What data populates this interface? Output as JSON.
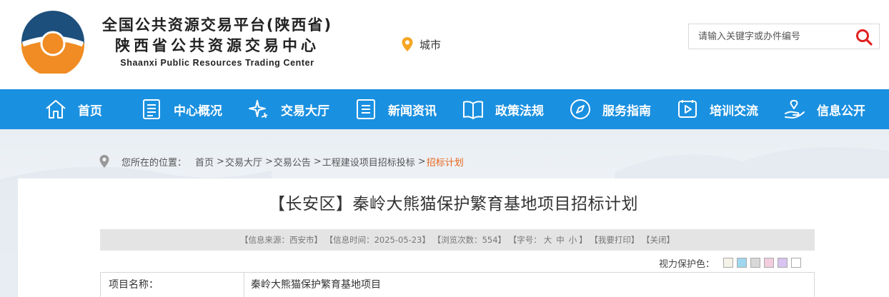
{
  "header": {
    "title_cn_line1": "全国公共资源交易平台(陕西省)",
    "title_cn_line2": "陕西省公共资源交易中心",
    "title_en": "Shaanxi Public Resources Trading Center",
    "city_label": "城市",
    "search_placeholder": "请输入关键字或办件编号"
  },
  "nav": {
    "items": [
      {
        "label": "首页",
        "icon": "home-icon"
      },
      {
        "label": "中心概况",
        "icon": "document-icon"
      },
      {
        "label": "交易大厅",
        "icon": "sparkle-icon"
      },
      {
        "label": "新闻资讯",
        "icon": "list-icon"
      },
      {
        "label": "政策法规",
        "icon": "book-icon"
      },
      {
        "label": "服务指南",
        "icon": "compass-icon"
      },
      {
        "label": "培训交流",
        "icon": "play-icon"
      },
      {
        "label": "信息公开",
        "icon": "hand-icon"
      }
    ]
  },
  "breadcrumb": {
    "prefix": "您所在的位置：",
    "items": [
      "首页",
      "交易大厅",
      "交易公告",
      "工程建设项目招标投标"
    ],
    "separator": ">",
    "current": "招标计划"
  },
  "article": {
    "title": "【长安区】秦岭大熊猫保护繁育基地项目招标计划",
    "source": "【信息来源：西安市】",
    "time": "【信息时间：2025-05-23】",
    "views": "【浏览次数：554】",
    "font_size_label": "【字号：",
    "size_large": "大",
    "size_medium": "中",
    "size_small": "小",
    "font_size_end": "】",
    "print": "【我要打印】",
    "close": "【关闭】",
    "eye_protect_label": "视力保护色：",
    "swatch_colors": [
      "#f5f2e8",
      "#9fd7ef",
      "#d8d8d8",
      "#f2cede",
      "#d9c3f0",
      "#ffffff"
    ]
  },
  "table": {
    "rows": [
      {
        "label": "项目名称：",
        "value": "秦岭大熊猫保护繁育基地项目"
      }
    ]
  },
  "colors": {
    "nav_bg": "#1a90e0",
    "accent_orange": "#f08c23",
    "logo_blue": "#1d4f7c",
    "active_crumb": "#e8651a"
  }
}
